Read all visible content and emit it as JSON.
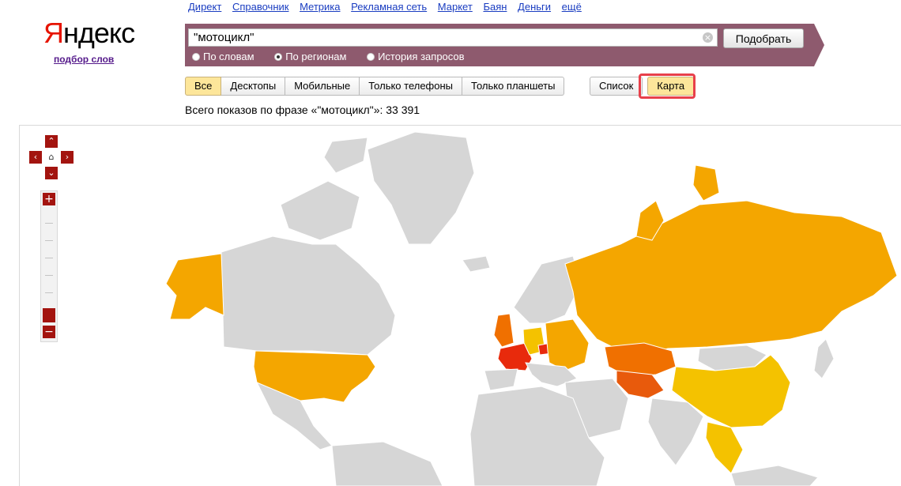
{
  "logo": {
    "first_letter": "Я",
    "rest": "ндекс",
    "subtitle": "подбор слов"
  },
  "services": [
    "Директ",
    "Справочник",
    "Метрика",
    "Рекламная сеть",
    "Маркет",
    "Баян",
    "Деньги",
    "ещё"
  ],
  "search": {
    "value": "\"мотоцикл\"",
    "submit_label": "Подобрать"
  },
  "modes": [
    {
      "label": "По словам",
      "selected": false
    },
    {
      "label": "По регионам",
      "selected": true
    },
    {
      "label": "История запросов",
      "selected": false
    }
  ],
  "device_tabs": [
    {
      "label": "Все",
      "active": true
    },
    {
      "label": "Десктопы",
      "active": false
    },
    {
      "label": "Мобильные",
      "active": false
    },
    {
      "label": "Только телефоны",
      "active": false
    },
    {
      "label": "Только планшеты",
      "active": false
    }
  ],
  "view_tabs": [
    {
      "label": "Список",
      "active": false
    },
    {
      "label": "Карта",
      "active": true
    }
  ],
  "total_text": "Всего показов по фразе «\"мотоцикл\"»: 33 391",
  "map": {
    "colors": {
      "land": "#d6d6d6",
      "low": "#f4c200",
      "mid": "#f4a600",
      "high": "#f07000",
      "top": "#e82a0c"
    }
  }
}
